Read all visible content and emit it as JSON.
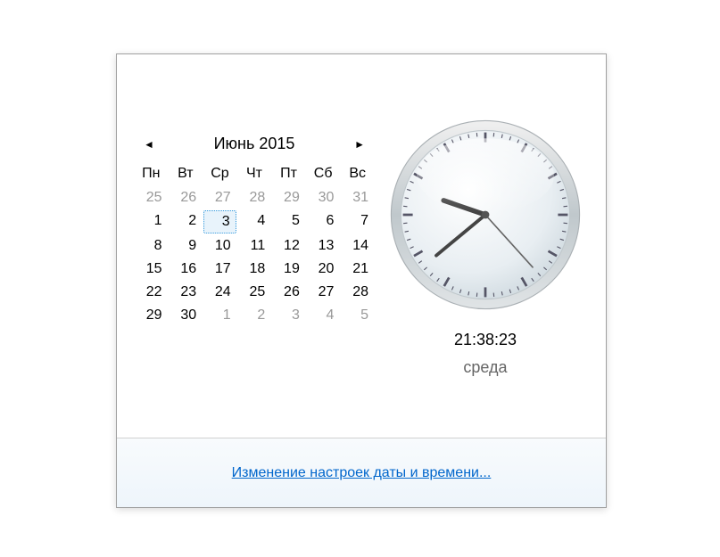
{
  "calendar": {
    "month_title": "Июнь 2015",
    "weekdays": [
      "Пн",
      "Вт",
      "Ср",
      "Чт",
      "Пт",
      "Сб",
      "Вс"
    ],
    "days": [
      {
        "n": 25,
        "other": true
      },
      {
        "n": 26,
        "other": true
      },
      {
        "n": 27,
        "other": true
      },
      {
        "n": 28,
        "other": true
      },
      {
        "n": 29,
        "other": true
      },
      {
        "n": 30,
        "other": true
      },
      {
        "n": 31,
        "other": true
      },
      {
        "n": 1
      },
      {
        "n": 2
      },
      {
        "n": 3,
        "selected": true
      },
      {
        "n": 4
      },
      {
        "n": 5
      },
      {
        "n": 6
      },
      {
        "n": 7
      },
      {
        "n": 8
      },
      {
        "n": 9
      },
      {
        "n": 10
      },
      {
        "n": 11
      },
      {
        "n": 12
      },
      {
        "n": 13
      },
      {
        "n": 14
      },
      {
        "n": 15
      },
      {
        "n": 16
      },
      {
        "n": 17
      },
      {
        "n": 18
      },
      {
        "n": 19
      },
      {
        "n": 20
      },
      {
        "n": 21
      },
      {
        "n": 22
      },
      {
        "n": 23
      },
      {
        "n": 24
      },
      {
        "n": 25
      },
      {
        "n": 26
      },
      {
        "n": 27
      },
      {
        "n": 28
      },
      {
        "n": 29
      },
      {
        "n": 30
      },
      {
        "n": 1,
        "other": true
      },
      {
        "n": 2,
        "other": true
      },
      {
        "n": 3,
        "other": true
      },
      {
        "n": 4,
        "other": true
      },
      {
        "n": 5,
        "other": true
      }
    ]
  },
  "clock": {
    "time": "21:38:23",
    "day_name": "среда",
    "hours": 21,
    "minutes": 38,
    "seconds": 23
  },
  "footer": {
    "settings_link": "Изменение настроек даты и времени..."
  }
}
